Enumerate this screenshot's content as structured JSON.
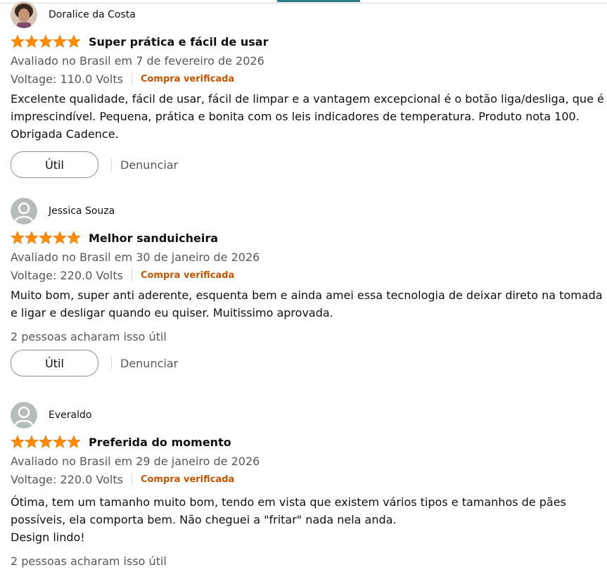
{
  "colors": {
    "star": "#ff8c00",
    "verified": "#c45500",
    "muted": "#565959",
    "accent_line": "#2d7a84"
  },
  "reviews": [
    {
      "author": "Doralice da Costa",
      "avatar": "profile-photo",
      "rating": 5,
      "title": "Super prática e fácil de usar",
      "meta": "Avaliado no Brasil em 7 de fevereiro de 2026",
      "voltage": "Voltage: 110.0 Volts",
      "verified": "Compra verificada",
      "body": "Excelente qualidade, fácil de usar, fácil de limpar e a vantagem excepcional é o botão liga/desliga, que é imprescindível. Pequena, prática e bonita com os leis indicadores de temperatura. Produto nota 100. Obrigada Cadence.",
      "helpful_count": "",
      "helpful_label": "Útil",
      "report_label": "Denunciar"
    },
    {
      "author": "Jessica Souza",
      "avatar": "default-avatar",
      "rating": 5,
      "title": "Melhor sanduicheira",
      "meta": "Avaliado no Brasil em 30 de janeiro de 2026",
      "voltage": "Voltage: 220.0 Volts",
      "verified": "Compra verificada",
      "body": "Muito bom, super anti aderente, esquenta bem e ainda amei essa tecnologia de deixar direto na tomada e ligar e desligar quando eu quiser. Muitissimo aprovada.",
      "helpful_count": "2 pessoas acharam isso útil",
      "helpful_label": "Útil",
      "report_label": "Denunciar"
    },
    {
      "author": "Everaldo",
      "avatar": "default-avatar",
      "rating": 5,
      "title": "Preferida do momento",
      "meta": "Avaliado no Brasil em 29 de janeiro de 2026",
      "voltage": "Voltage: 220.0 Volts",
      "verified": "Compra verificada",
      "body_lines": [
        "Ótima, tem um tamanho muito bom, tendo em vista que existem vários tipos e tamanhos de pães possíveis, ela comporta bem. Não cheguei a \"fritar\" nada nela anda.",
        "Design lindo!"
      ],
      "helpful_count": "2 pessoas acharam isso útil"
    }
  ]
}
